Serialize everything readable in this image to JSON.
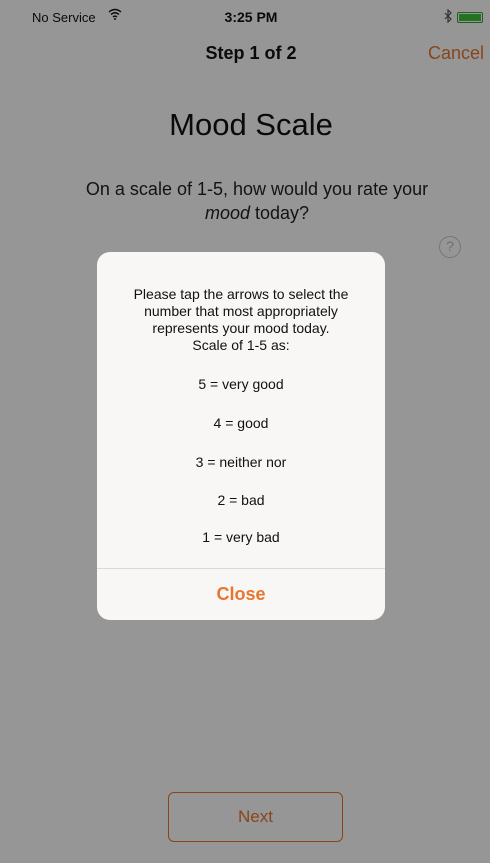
{
  "status_bar": {
    "carrier": "No Service",
    "time": "3:25 PM"
  },
  "nav": {
    "title": "Step 1 of 2",
    "cancel_label": "Cancel"
  },
  "main": {
    "title": "Mood Scale",
    "question_prefix": "On a scale of 1-5, how would you rate your",
    "question_emphasis": "mood",
    "question_suffix": " today?",
    "help_glyph": "?",
    "next_label": "Next"
  },
  "alert": {
    "message_lines": [
      "Please tap the arrows to select the",
      "number that most appropriately",
      "represents your mood today.",
      "Scale of 1-5 as:"
    ],
    "scale": [
      "5 = very good",
      "4 = good",
      "3 = neither nor",
      "2 = bad",
      "1 = very bad"
    ],
    "close_label": "Close"
  },
  "colors": {
    "accent": "#e8762e",
    "battery": "#3dc43d",
    "overlay": "rgba(0,0,0,0.41)"
  },
  "icons": [
    "wifi-icon",
    "bluetooth-icon",
    "battery-icon",
    "help-icon"
  ]
}
